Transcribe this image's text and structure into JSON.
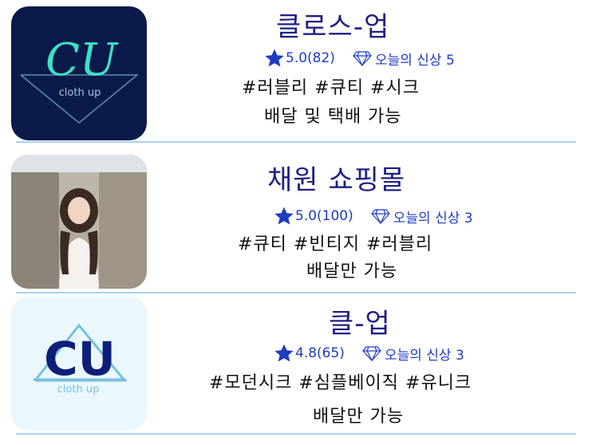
{
  "shops": [
    {
      "name": "클로스-업",
      "rating": "5.0(82)",
      "new_today": "오늘의 신상 5",
      "tags": "#러블리 #큐티 #시크",
      "delivery": "배달 및 택배 가능",
      "logo": {
        "text": "CU",
        "subtext": "cloth up"
      }
    },
    {
      "name": "채원 쇼핑몰",
      "rating": "5.0(100)",
      "new_today": "오늘의 신상 3",
      "tags": "#큐티 #빈티지 #러블리",
      "delivery": "배달만 가능"
    },
    {
      "name": "클-업",
      "rating": "4.8(65)",
      "new_today": "오늘의 신상 3",
      "tags": "#모던시크 #심플베이직 #유니크",
      "delivery": "배달만 가능",
      "logo": {
        "text": "CU",
        "subtext": "cloth up"
      }
    }
  ],
  "colors": {
    "accent": "#1f3cc2",
    "divider": "#a9d1f6",
    "logo1_bg": "#0b1a4b",
    "logo1_text": "#3ee0c4",
    "logo3_bg": "#eaf8fd",
    "logo3_text": "#0e1f7a"
  },
  "icons": {
    "rating": "star-icon",
    "new": "diamond-icon"
  }
}
